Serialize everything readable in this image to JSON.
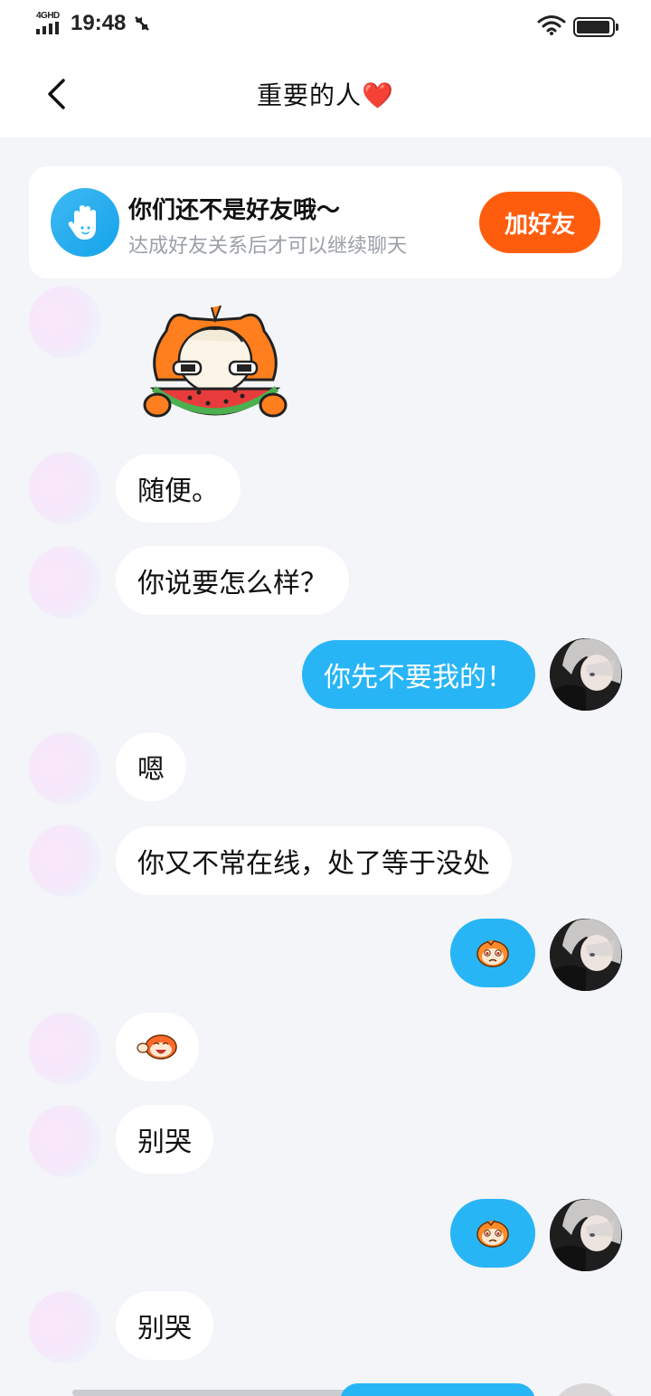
{
  "status_bar": {
    "network": "4GHD",
    "time": "19:48"
  },
  "header": {
    "title": "重要的人",
    "title_emoji": "❤️"
  },
  "friend_card": {
    "title": "你们还不是好友哦～",
    "subtitle": "达成好友关系后才可以继续聊天",
    "button_label": "加好友"
  },
  "messages": [
    {
      "side": "left",
      "type": "sticker",
      "sticker": "watermelon-sticker"
    },
    {
      "side": "left",
      "type": "text",
      "text": "随便。"
    },
    {
      "side": "left",
      "type": "text",
      "text": "你说要怎么样？"
    },
    {
      "side": "right",
      "type": "text",
      "text": "你先不要我的！"
    },
    {
      "side": "left",
      "type": "text",
      "text": "嗯"
    },
    {
      "side": "left",
      "type": "text",
      "text": "你又不常在线，处了等于没处"
    },
    {
      "side": "right",
      "type": "emoji",
      "sticker": "crying-monkey-emoji"
    },
    {
      "side": "left",
      "type": "emoji",
      "sticker": "laughing-monkey-emoji"
    },
    {
      "side": "left",
      "type": "text",
      "text": "别哭"
    },
    {
      "side": "right",
      "type": "emoji",
      "sticker": "crying-monkey-emoji"
    },
    {
      "side": "left",
      "type": "text",
      "text": "别哭"
    }
  ],
  "colors": {
    "accent_blue": "#28b5f5",
    "add_button": "#ff5d0e",
    "background": "#f3f5f8"
  }
}
